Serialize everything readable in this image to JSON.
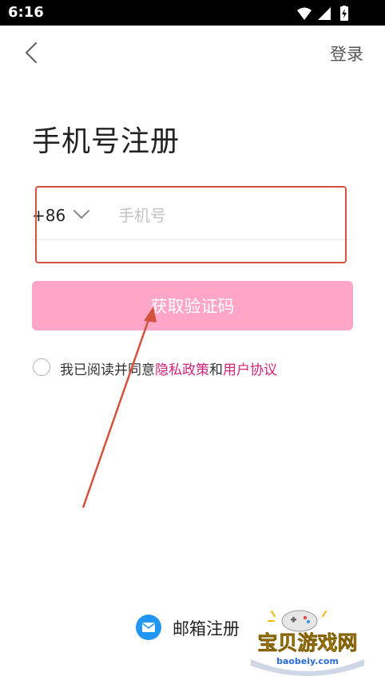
{
  "status_bar": {
    "time": "6:16",
    "icons": [
      "wifi-icon",
      "signal-icon",
      "battery-charging-icon"
    ]
  },
  "header": {
    "back_icon": "chevron-left-icon",
    "login_label": "登录"
  },
  "title": "手机号注册",
  "phone": {
    "country_code": "+86",
    "dropdown_icon": "chevron-down-icon",
    "placeholder": "手机号",
    "value": ""
  },
  "get_code_label": "获取验证码",
  "agreement": {
    "prefix": "我已阅读并同意",
    "privacy_label": "隐私政策",
    "joiner": "和",
    "terms_label": "用户协议"
  },
  "email_register": {
    "icon": "mail-icon",
    "label": "邮箱注册"
  },
  "watermark": {
    "title": "宝贝游戏网",
    "url": "baobeiy.com"
  },
  "colors": {
    "accent_pink": "#ffa6c8",
    "link_magenta": "#d4237a",
    "annotation_red": "#d3523c",
    "mail_blue": "#2196f3"
  }
}
